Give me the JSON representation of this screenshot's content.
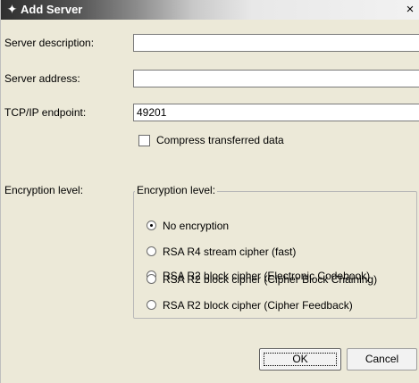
{
  "window": {
    "title": "Add Server",
    "icon": "star-icon",
    "close_label": "×"
  },
  "form": {
    "description_label": "Server description:",
    "description_value": "",
    "address_label": "Server address:",
    "address_value": "",
    "endpoint_label": "TCP/IP endpoint:",
    "endpoint_value": "49201",
    "compress_label": "Compress transferred data",
    "compress_checked": false,
    "encryption_label": "Encryption level:"
  },
  "encryption_group": {
    "title": "Encryption level:",
    "options": [
      {
        "label": "No encryption",
        "selected": true
      },
      {
        "label": "RSA R4 stream cipher (fast)",
        "selected": false
      },
      {
        "label": "RSA R2 block cipher (Electronic Codebook)",
        "selected": false
      },
      {
        "label": "RSA R2 block cipher (Cipher Block Chaining)",
        "selected": false
      },
      {
        "label": "RSA R2 block cipher (Cipher Feedback)",
        "selected": false
      }
    ]
  },
  "buttons": {
    "ok_label": "OK",
    "cancel_label": "Cancel"
  }
}
